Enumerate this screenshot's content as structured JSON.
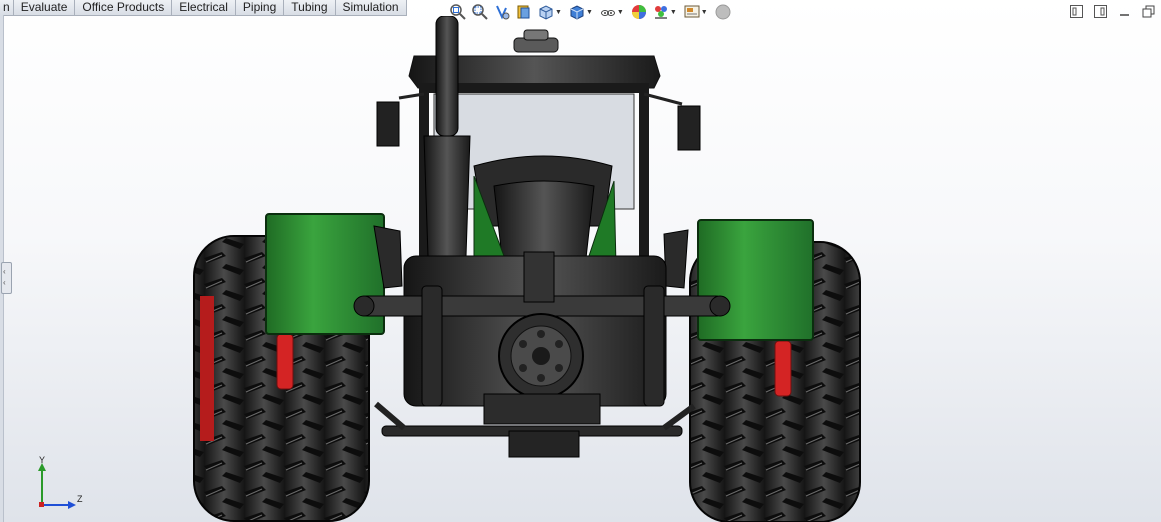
{
  "command_manager": {
    "tabs": [
      "n",
      "Evaluate",
      "Office Products",
      "Electrical",
      "Piping",
      "Tubing",
      "Simulation"
    ]
  },
  "heads_up_toolbar": {
    "icons": [
      "zoom-to-fit-icon",
      "zoom-to-area-icon",
      "previous-view-icon",
      "section-view-icon",
      "view-orientation-icon",
      "display-style-icon",
      "hide-show-items-icon",
      "edit-appearance-icon",
      "apply-scene-icon",
      "view-settings-icon",
      "realview-icon"
    ]
  },
  "window_controls": {
    "icons": [
      "tile-horizontal-icon",
      "tile-vertical-icon",
      "minimize-icon",
      "restore-icon"
    ]
  },
  "triad": {
    "y_label": "Y",
    "z_label": "Z"
  },
  "colors": {
    "fender_green": "#2c8a32",
    "tire_dark": "#2a2a2a",
    "red_hub": "#cc1f1f",
    "triad_y": "#2a9a2a",
    "triad_z": "#1f4fd6"
  }
}
